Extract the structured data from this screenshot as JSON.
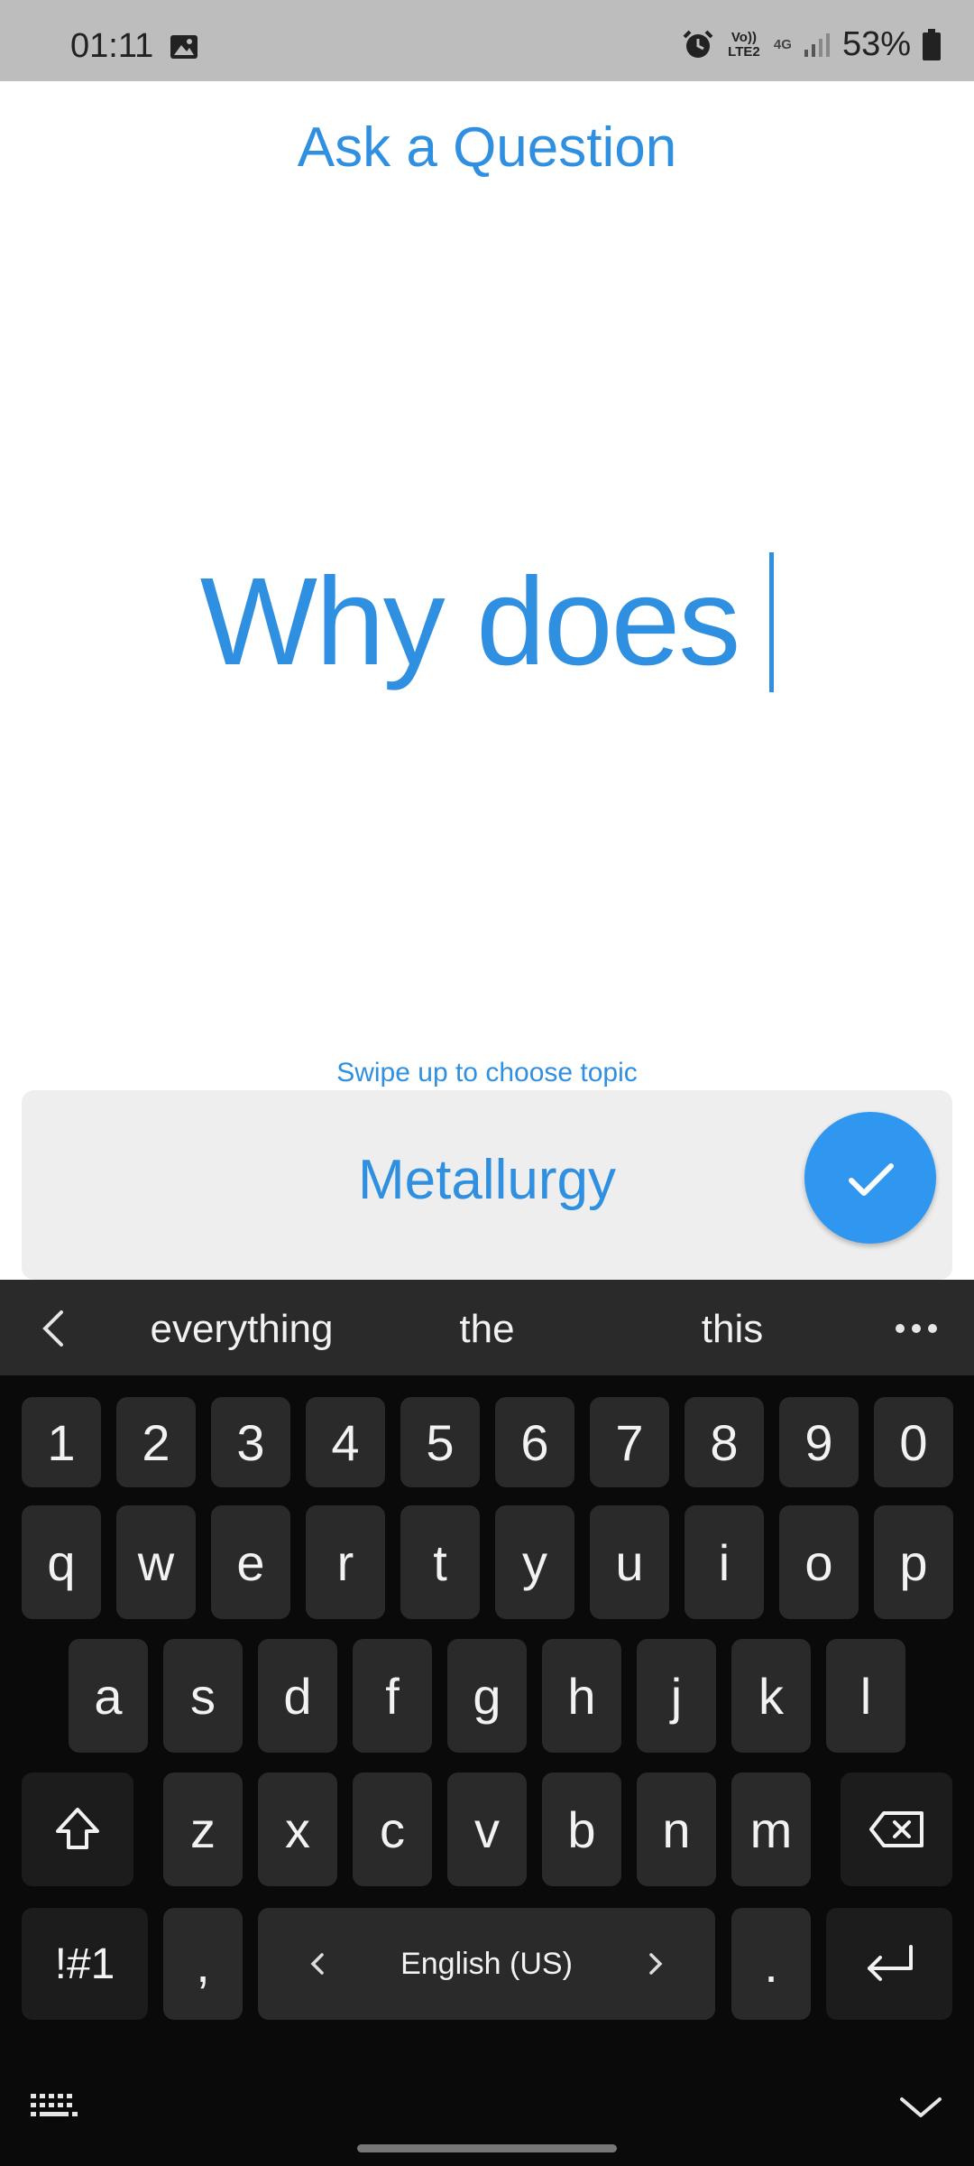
{
  "status_bar": {
    "time": "01:11",
    "volte": "Vo)) LTE2",
    "network": "4G",
    "battery": "53%"
  },
  "page": {
    "title": "Ask a Question",
    "question_text": "Why does",
    "swipe_hint": "Swipe up to choose topic",
    "topic": "Metallurgy"
  },
  "keyboard": {
    "suggestions": [
      "everything",
      "the",
      "this"
    ],
    "row_numbers": [
      "1",
      "2",
      "3",
      "4",
      "5",
      "6",
      "7",
      "8",
      "9",
      "0"
    ],
    "row_top": [
      "q",
      "w",
      "e",
      "r",
      "t",
      "y",
      "u",
      "i",
      "o",
      "p"
    ],
    "row_middle": [
      "a",
      "s",
      "d",
      "f",
      "g",
      "h",
      "j",
      "k",
      "l"
    ],
    "row_bottom": [
      "z",
      "x",
      "c",
      "v",
      "b",
      "n",
      "m"
    ],
    "symbols_key": "!#1",
    "comma_key": ",",
    "space_label": "English (US)",
    "period_key": "."
  },
  "colors": {
    "accent": "#2f8fe0",
    "fab": "#2f97f0",
    "keyboard_bg": "#0a0a0a",
    "key_bg": "#2a2a2a"
  }
}
